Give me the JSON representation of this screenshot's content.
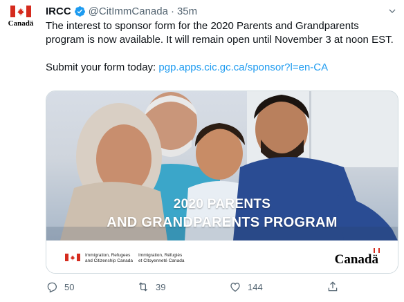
{
  "account": {
    "avatar_wordmark": "Canadä",
    "name": "IRCC",
    "handle": "@CitImmCanada",
    "separator": "·",
    "time": "35m"
  },
  "tweet": {
    "text": "The interest to sponsor form for the 2020 Parents and Grandparents program is now available. It will remain open until November 3 at noon EST.",
    "cta": "Submit your form today: ",
    "link": "pgp.apps.cic.gc.ca/sponsor?l=en-CA"
  },
  "card": {
    "banner_line1": "2020 PARENTS",
    "banner_line2": "AND GRANDPARENTS PROGRAM",
    "fip_en": [
      "Immigration, Refugees",
      "and Citizenship Canada"
    ],
    "fip_fr": [
      "Immigration, Réfugiés",
      "et Citoyenneté Canada"
    ],
    "wordmark": "Canadä"
  },
  "actions": {
    "replies": "50",
    "retweets": "39",
    "likes": "144"
  },
  "colors": {
    "link": "#1d9bf0",
    "canada_red": "#d52b1e",
    "muted": "#536471"
  }
}
